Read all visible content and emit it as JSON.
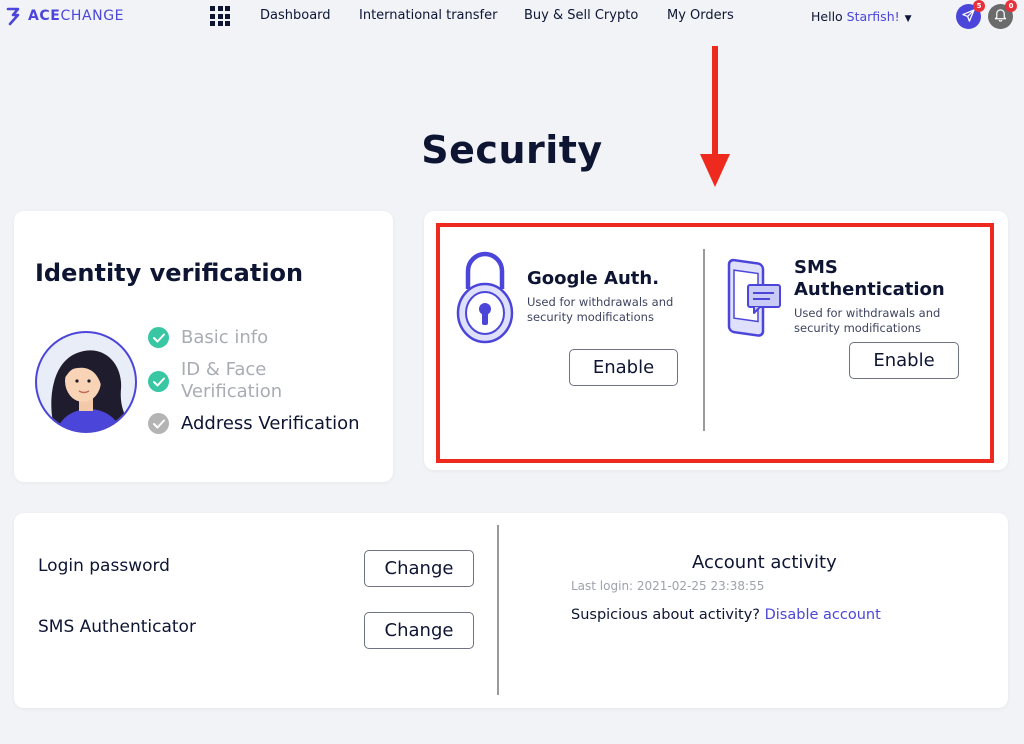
{
  "brand": {
    "name_bold": "ACE",
    "name_light": "CHANGE",
    "accent": "#4b46d9",
    "alert": "#ee2a1e"
  },
  "nav": {
    "links": [
      "Dashboard",
      "International transfer",
      "Buy & Sell Crypto",
      "My Orders"
    ],
    "greeting": "Hello",
    "user_name": "Starfish!",
    "send_badge": "5",
    "bell_badge": "0"
  },
  "page_title": "Security",
  "identity": {
    "title": "Identity verification",
    "steps": [
      {
        "label_line1": "Basic info",
        "label_line2": "",
        "status": "done"
      },
      {
        "label_line1": "ID & Face",
        "label_line2": "Verification",
        "status": "done"
      },
      {
        "label_line1": "Address Verification",
        "label_line2": "",
        "status": "pending"
      }
    ]
  },
  "google_auth": {
    "title": "Google Auth.",
    "desc_line1": "Used for withdrawals and",
    "desc_line2": "security modifications",
    "button": "Enable"
  },
  "sms_auth": {
    "title_line1": "SMS",
    "title_line2": "Authentication",
    "desc_line1": "Used for withdrawals and",
    "desc_line2": "security modifications",
    "button": "Enable"
  },
  "settings": {
    "login_password_label": "Login password",
    "login_password_button": "Change",
    "sms_authenticator_label": "SMS Authenticator",
    "sms_authenticator_button": "Change"
  },
  "activity": {
    "title": "Account activity",
    "last_login": "Last login: 2021-02-25 23:38:55",
    "suspicious_text": "Suspicious about activity?",
    "disable_link": "Disable account"
  }
}
